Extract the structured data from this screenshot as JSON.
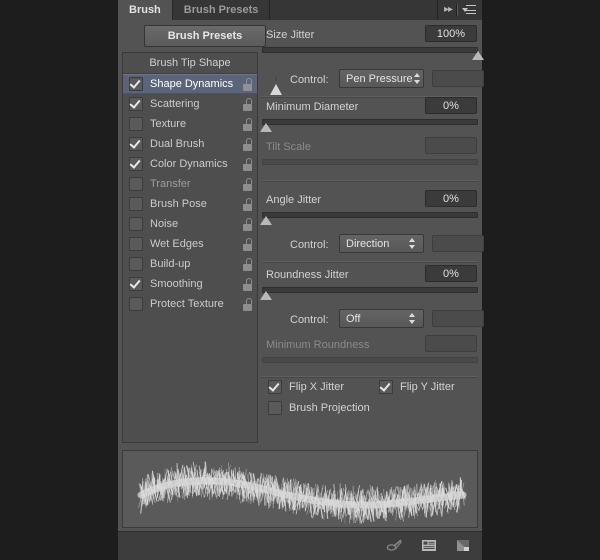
{
  "window": {
    "background_color": "#1d1d1d",
    "panel_color": "#535353"
  },
  "tabs": [
    {
      "label": "Brush",
      "active": true
    },
    {
      "label": "Brush Presets",
      "active": false
    }
  ],
  "tab_icons": {
    "collapse": "▸▸",
    "collapse_name": "collapse-to-icons",
    "menu_name": "panel-menu"
  },
  "presets_button": {
    "label": "Brush Presets"
  },
  "brush_list": {
    "header": "Brush Tip Shape",
    "items": [
      {
        "label": "Shape Dynamics",
        "checked": true,
        "selected": true,
        "dim": false,
        "locked": false
      },
      {
        "label": "Scattering",
        "checked": true,
        "selected": false,
        "dim": false,
        "locked": false
      },
      {
        "label": "Texture",
        "checked": false,
        "selected": false,
        "dim": false,
        "locked": false
      },
      {
        "label": "Dual Brush",
        "checked": true,
        "selected": false,
        "dim": false,
        "locked": false
      },
      {
        "label": "Color Dynamics",
        "checked": true,
        "selected": false,
        "dim": false,
        "locked": false
      },
      {
        "label": "Transfer",
        "checked": false,
        "selected": false,
        "dim": true,
        "locked": false
      },
      {
        "label": "Brush Pose",
        "checked": false,
        "selected": false,
        "dim": false,
        "locked": false
      },
      {
        "label": "Noise",
        "checked": false,
        "selected": false,
        "dim": false,
        "locked": false
      },
      {
        "label": "Wet Edges",
        "checked": false,
        "selected": false,
        "dim": false,
        "locked": false
      },
      {
        "label": "Build-up",
        "checked": false,
        "selected": false,
        "dim": false,
        "locked": false
      },
      {
        "label": "Smoothing",
        "checked": true,
        "selected": false,
        "dim": false,
        "locked": false
      },
      {
        "label": "Protect Texture",
        "checked": false,
        "selected": false,
        "dim": false,
        "locked": false
      }
    ]
  },
  "controls": {
    "size_jitter": {
      "label": "Size Jitter",
      "value": "100%",
      "slider_percent": 100
    },
    "size_control": {
      "label": "Control:",
      "selected": "Pen Pressure",
      "warning": true,
      "extra_value": ""
    },
    "minimum_diameter": {
      "label": "Minimum Diameter",
      "value": "0%",
      "slider_percent": 0
    },
    "tilt_scale": {
      "label": "Tilt Scale",
      "value": "",
      "slider_percent": 0,
      "disabled": true
    },
    "angle_jitter": {
      "label": "Angle Jitter",
      "value": "0%",
      "slider_percent": 0
    },
    "angle_control": {
      "label": "Control:",
      "selected": "Direction",
      "warning": false,
      "extra_value": ""
    },
    "roundness_jitter": {
      "label": "Roundness Jitter",
      "value": "0%",
      "slider_percent": 0
    },
    "roundness_control": {
      "label": "Control:",
      "selected": "Off",
      "warning": false,
      "extra_value": ""
    },
    "minimum_roundness": {
      "label": "Minimum Roundness",
      "value": "",
      "slider_percent": 0,
      "disabled": true
    },
    "flip_x_jitter": {
      "label": "Flip X Jitter",
      "checked": true
    },
    "flip_y_jitter": {
      "label": "Flip Y Jitter",
      "checked": true
    },
    "brush_projection": {
      "label": "Brush Projection",
      "checked": false
    }
  },
  "preview": {
    "name": "brush-stroke-preview"
  },
  "footer": {
    "icons": [
      {
        "name": "toggle-live-tip-brush-icon"
      },
      {
        "name": "open-preset-manager-icon"
      },
      {
        "name": "create-new-brush-icon"
      }
    ]
  }
}
